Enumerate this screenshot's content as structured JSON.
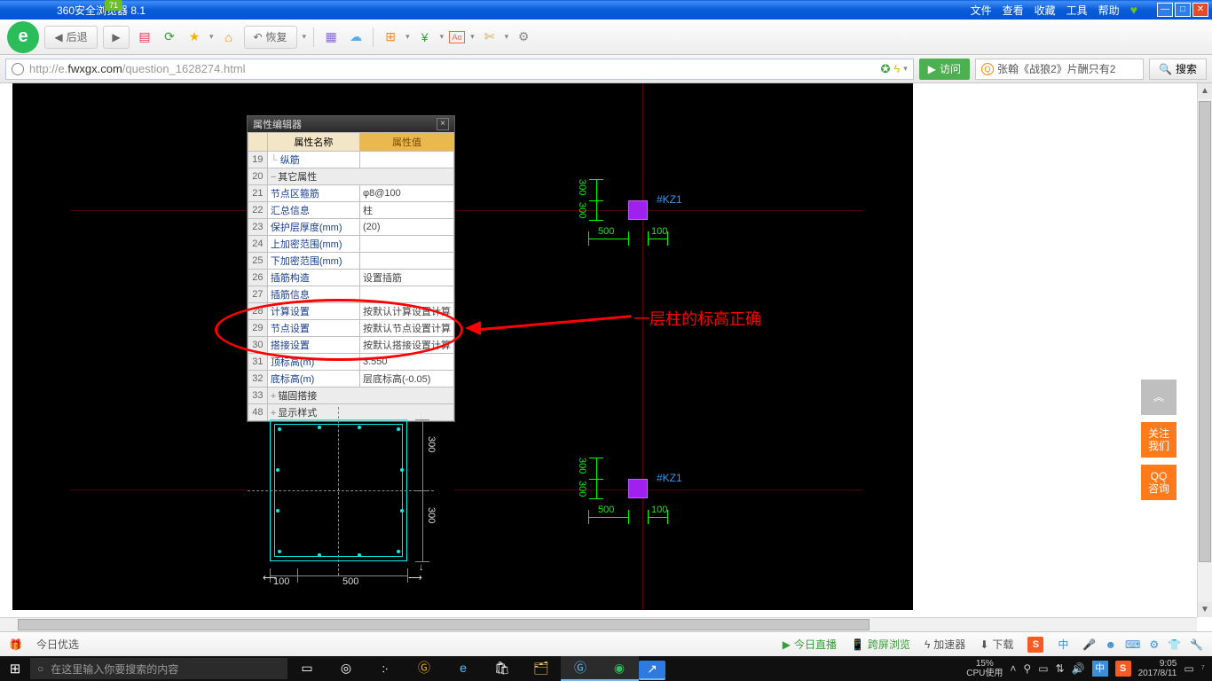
{
  "titlebar": {
    "badge": "71",
    "app": "360安全浏览器 8.1",
    "menu": [
      "文件",
      "查看",
      "收藏",
      "工具",
      "帮助"
    ]
  },
  "toolbar": {
    "back": "后退",
    "restore": "恢复"
  },
  "url": {
    "prefix": "http://e.",
    "highlight": "fwxgx.com",
    "suffix": "/question_1628274.html",
    "visit": "访问",
    "search_preview": "张翰《战狼2》片酬只有2",
    "search": "搜索"
  },
  "panel": {
    "title": "属性编辑器",
    "cols": [
      "属性名称",
      "属性值"
    ],
    "rows": [
      {
        "n": "19",
        "name": "纵筋",
        "val": "",
        "indent": 1,
        "black": false
      },
      {
        "n": "20",
        "name": "其它属性",
        "val": "",
        "sect": true,
        "tree": "−"
      },
      {
        "n": "21",
        "name": "节点区箍筋",
        "val": "φ8@100"
      },
      {
        "n": "22",
        "name": "汇总信息",
        "val": "柱"
      },
      {
        "n": "23",
        "name": "保护层厚度(mm)",
        "val": "(20)"
      },
      {
        "n": "24",
        "name": "上加密范围(mm)",
        "val": ""
      },
      {
        "n": "25",
        "name": "下加密范围(mm)",
        "val": ""
      },
      {
        "n": "26",
        "name": "插筋构造",
        "val": "设置插筋"
      },
      {
        "n": "27",
        "name": "插筋信息",
        "val": ""
      },
      {
        "n": "28",
        "name": "计算设置",
        "val": "按默认计算设置计算"
      },
      {
        "n": "29",
        "name": "节点设置",
        "val": "按默认节点设置计算"
      },
      {
        "n": "30",
        "name": "搭接设置",
        "val": "按默认搭接设置计算"
      },
      {
        "n": "31",
        "name": "顶标高(m)",
        "val": "3.550"
      },
      {
        "n": "32",
        "name": "底标高(m)",
        "val": "层底标高(-0.05)"
      },
      {
        "n": "33",
        "name": "锚固搭接",
        "val": "",
        "sect": true,
        "tree": "+"
      },
      {
        "n": "48",
        "name": "显示样式",
        "val": "",
        "sect": true,
        "tree": "+"
      }
    ]
  },
  "annotation": {
    "text": "一层柱的标高正确"
  },
  "cad": {
    "col_tag": "#KZ1",
    "dim_500": "500",
    "dim_100": "100",
    "dim_300": "300"
  },
  "side": {
    "top": "︽",
    "btn1": "关注\n我们",
    "btn2": "QQ\n咨询"
  },
  "bstatus": {
    "today": "今日优选",
    "live": "今日直播",
    "cross": "跨屏浏览",
    "accel": "加速器",
    "down": "下载",
    "cn": "中"
  },
  "taskbar": {
    "search_placeholder": "在这里输入你要搜索的内容",
    "cpu_pct": "15%",
    "cpu_lbl": "CPU使用",
    "time": "9:05",
    "date": "2017/8/11",
    "cn": "中"
  }
}
